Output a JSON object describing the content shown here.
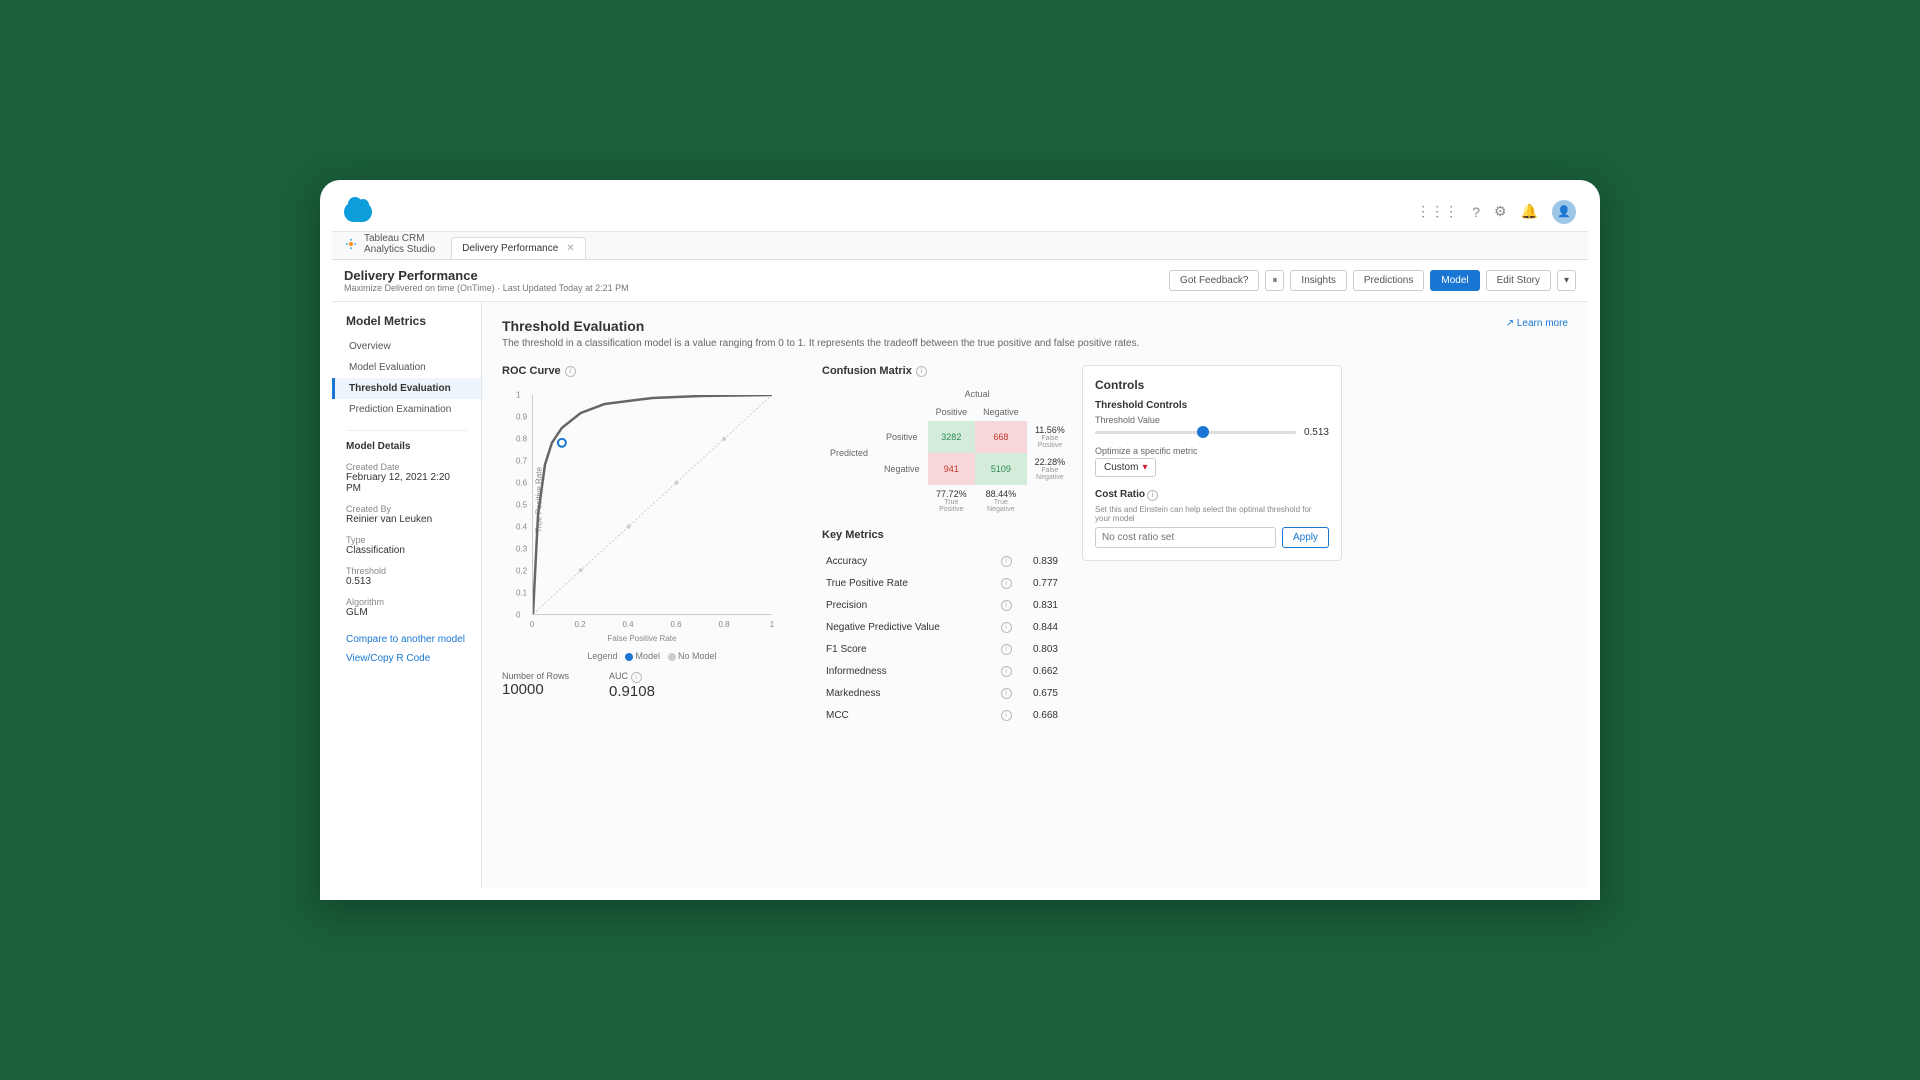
{
  "app": {
    "name_line1": "Tableau CRM",
    "name_line2": "Analytics Studio"
  },
  "tab": {
    "title": "Delivery Performance"
  },
  "header": {
    "title": "Delivery Performance",
    "subtitle": "Maximize Delivered on time (OnTime) · Last Updated Today at 2:21 PM",
    "buttons": {
      "feedback": "Got Feedback?",
      "insights": "Insights",
      "predictions": "Predictions",
      "model": "Model",
      "edit": "Edit Story"
    }
  },
  "sidebar": {
    "title": "Model Metrics",
    "items": [
      "Overview",
      "Model Evaluation",
      "Threshold Evaluation",
      "Prediction Examination"
    ],
    "active": 2,
    "details_title": "Model Details",
    "details": [
      {
        "label": "Created Date",
        "value": "February 12, 2021 2:20 PM"
      },
      {
        "label": "Created By",
        "value": "Reinier van Leuken"
      },
      {
        "label": "Type",
        "value": "Classification"
      },
      {
        "label": "Threshold",
        "value": "0.513"
      },
      {
        "label": "Algorithm",
        "value": "GLM"
      }
    ],
    "links": [
      "Compare to another model",
      "View/Copy R Code"
    ]
  },
  "main": {
    "title": "Threshold Evaluation",
    "desc": "The threshold in a classification model is a value ranging from 0 to 1. It represents the tradeoff between the true positive and false positive rates.",
    "learn_more": "Learn more"
  },
  "roc": {
    "title": "ROC Curve",
    "xlabel": "False Positive Rate",
    "ylabel": "True Positive Rate",
    "legend_label": "Legend",
    "model_label": "Model",
    "nomodel_label": "No Model",
    "rows_label": "Number of Rows",
    "rows_value": "10000",
    "auc_label": "AUC",
    "auc_value": "0.9108"
  },
  "cm": {
    "title": "Confusion Matrix",
    "actual": "Actual",
    "predicted": "Predicted",
    "positive": "Positive",
    "negative": "Negative",
    "tp": "3282",
    "fp": "668",
    "fn": "941",
    "tn": "5109",
    "fp_pct": "11.56%",
    "fp_lbl": "False Positive",
    "fn_pct": "22.28%",
    "fn_lbl": "False Negative",
    "tpr_pct": "77.72%",
    "tpr_lbl": "True Positive",
    "tnr_pct": "88.44%",
    "tnr_lbl": "True Negative"
  },
  "km": {
    "title": "Key Metrics",
    "rows": [
      {
        "name": "Accuracy",
        "value": "0.839"
      },
      {
        "name": "True Positive Rate",
        "value": "0.777"
      },
      {
        "name": "Precision",
        "value": "0.831"
      },
      {
        "name": "Negative Predictive Value",
        "value": "0.844"
      },
      {
        "name": "F1 Score",
        "value": "0.803"
      },
      {
        "name": "Informedness",
        "value": "0.662"
      },
      {
        "name": "Markedness",
        "value": "0.675"
      },
      {
        "name": "MCC",
        "value": "0.668"
      }
    ]
  },
  "controls": {
    "title": "Controls",
    "threshold_title": "Threshold Controls",
    "threshold_label": "Threshold Value",
    "threshold_value": "0.513",
    "optimize_label": "Optimize a specific metric",
    "optimize_select": "Custom",
    "cost_title": "Cost Ratio",
    "cost_desc": "Set this and Einstein can help select the optimal threshold for your model",
    "cost_placeholder": "No cost ratio set",
    "apply": "Apply"
  },
  "chart_data": {
    "type": "line",
    "title": "ROC Curve",
    "xlabel": "False Positive Rate",
    "ylabel": "True Positive Rate",
    "xlim": [
      0,
      1
    ],
    "ylim": [
      0,
      1
    ],
    "series": [
      {
        "name": "Model",
        "x": [
          0,
          0.02,
          0.05,
          0.08,
          0.12,
          0.2,
          0.3,
          0.5,
          0.7,
          1
        ],
        "y": [
          0,
          0.45,
          0.68,
          0.78,
          0.85,
          0.92,
          0.96,
          0.985,
          0.995,
          1
        ]
      },
      {
        "name": "No Model",
        "x": [
          0,
          1
        ],
        "y": [
          0,
          1
        ]
      }
    ],
    "marker": {
      "x": 0.12,
      "y": 0.78
    },
    "auc": 0.9108,
    "n_rows": 10000
  }
}
